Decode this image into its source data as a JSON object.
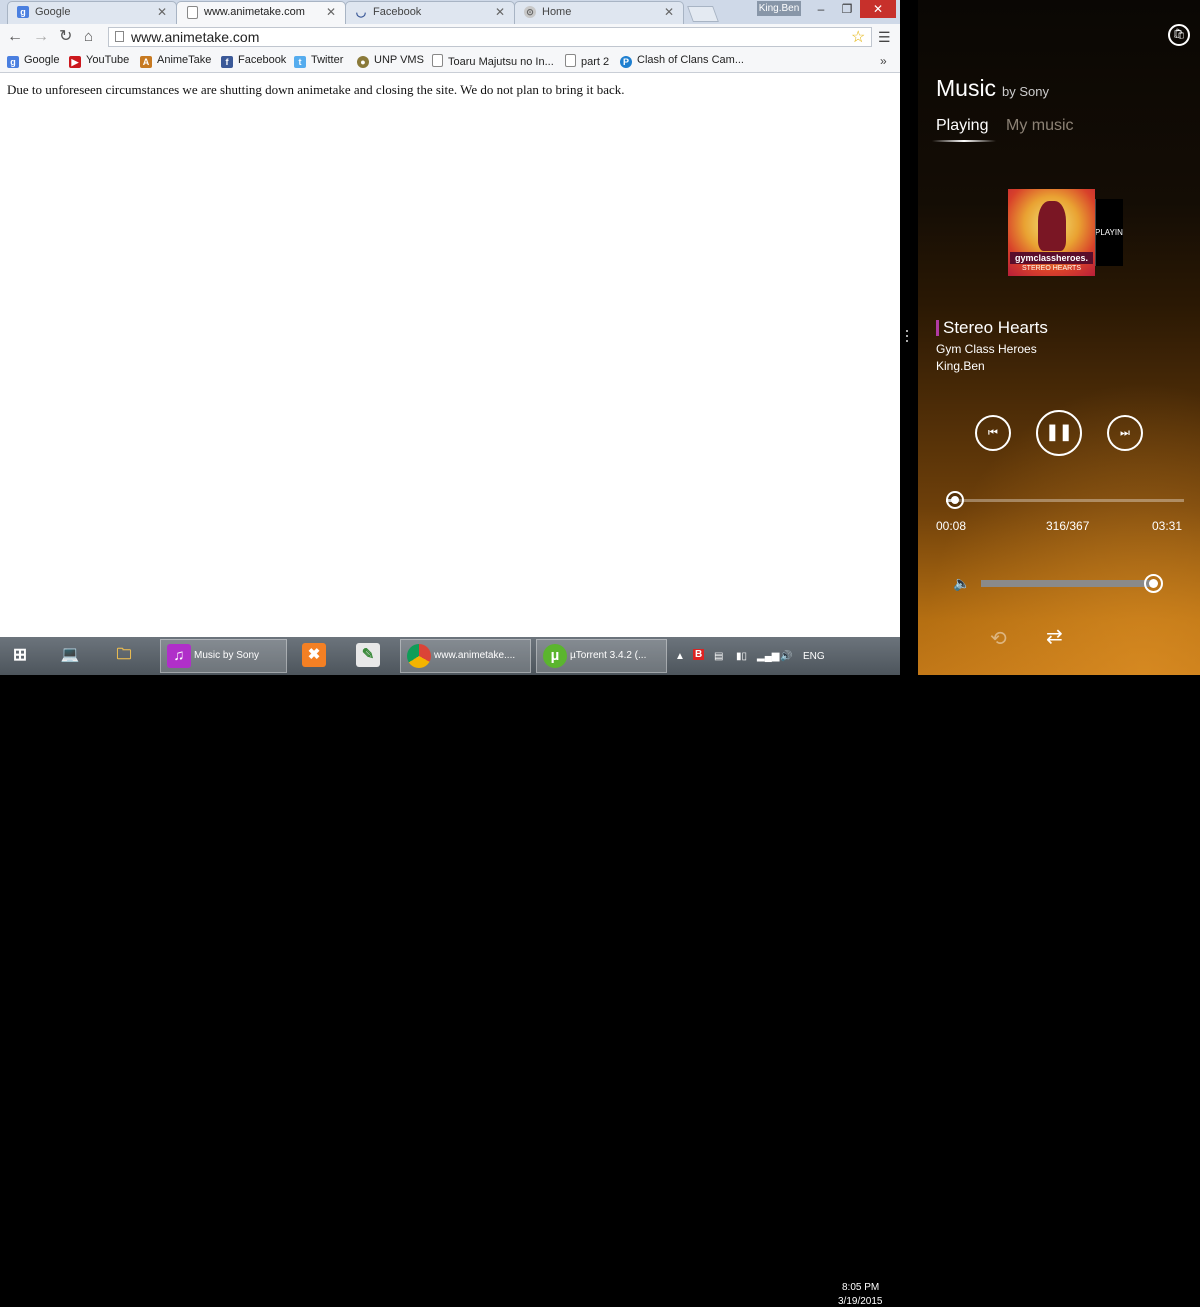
{
  "browser": {
    "tabs": [
      {
        "title": "Google",
        "icon": "google-icon",
        "color": "#4a7fe0"
      },
      {
        "title": "www.animetake.com",
        "icon": "page-icon",
        "color": "#ffffff"
      },
      {
        "title": "Facebook",
        "icon": "loading-icon",
        "color": "#3b5998"
      },
      {
        "title": "Home",
        "icon": "home-tab-icon",
        "color": "#9a9a9a"
      }
    ],
    "profile_name": "King.Ben",
    "url": "www.animetake.com",
    "bookmarks": [
      {
        "label": "Google",
        "color": "#4a7fe0"
      },
      {
        "label": "YouTube",
        "color": "#cc181e"
      },
      {
        "label": "AnimeTake",
        "color": "#c77a22"
      },
      {
        "label": "Facebook",
        "color": "#3b5998"
      },
      {
        "label": "Twitter",
        "color": "#55acee"
      },
      {
        "label": "UNP VMS",
        "color": "#8a7a3a"
      },
      {
        "label": "Toaru Majutsu no In...",
        "color": "#ffffff"
      },
      {
        "label": "part 2",
        "color": "#ffffff"
      },
      {
        "label": "Clash of Clans Cam...",
        "color": "#1e7fd0"
      }
    ],
    "page_text": "Due to unforeseen circumstances we are shutting down animetake and closing the site. We do not plan to bring it back."
  },
  "music": {
    "app_title": "Music",
    "app_subtitle": "by Sony",
    "tabs": {
      "playing": "Playing",
      "my_music": "My music"
    },
    "album": {
      "band": "gymclassheroes.",
      "subtitle": "STEREO HEARTS"
    },
    "next_card_text": "PLAYING",
    "song": {
      "title": "Stereo Hearts",
      "artist": "Gym Class Heroes",
      "user": "King.Ben"
    },
    "elapsed": "00:08",
    "track_count": "316/367",
    "total": "03:31",
    "progress_fraction": 0.038,
    "volume_fraction": 0.98,
    "accent_color": "#b13aa4"
  },
  "taskbar": {
    "items": [
      {
        "label": "Music by Sony",
        "color": "#b02fc9"
      },
      {
        "label": "www.animetake....",
        "color": "#4caf50"
      },
      {
        "label": "µTorrent 3.4.2  (...",
        "color": "#5bb52e"
      }
    ],
    "language": "ENG",
    "time": "8:05 PM",
    "date": "3/19/2015"
  }
}
